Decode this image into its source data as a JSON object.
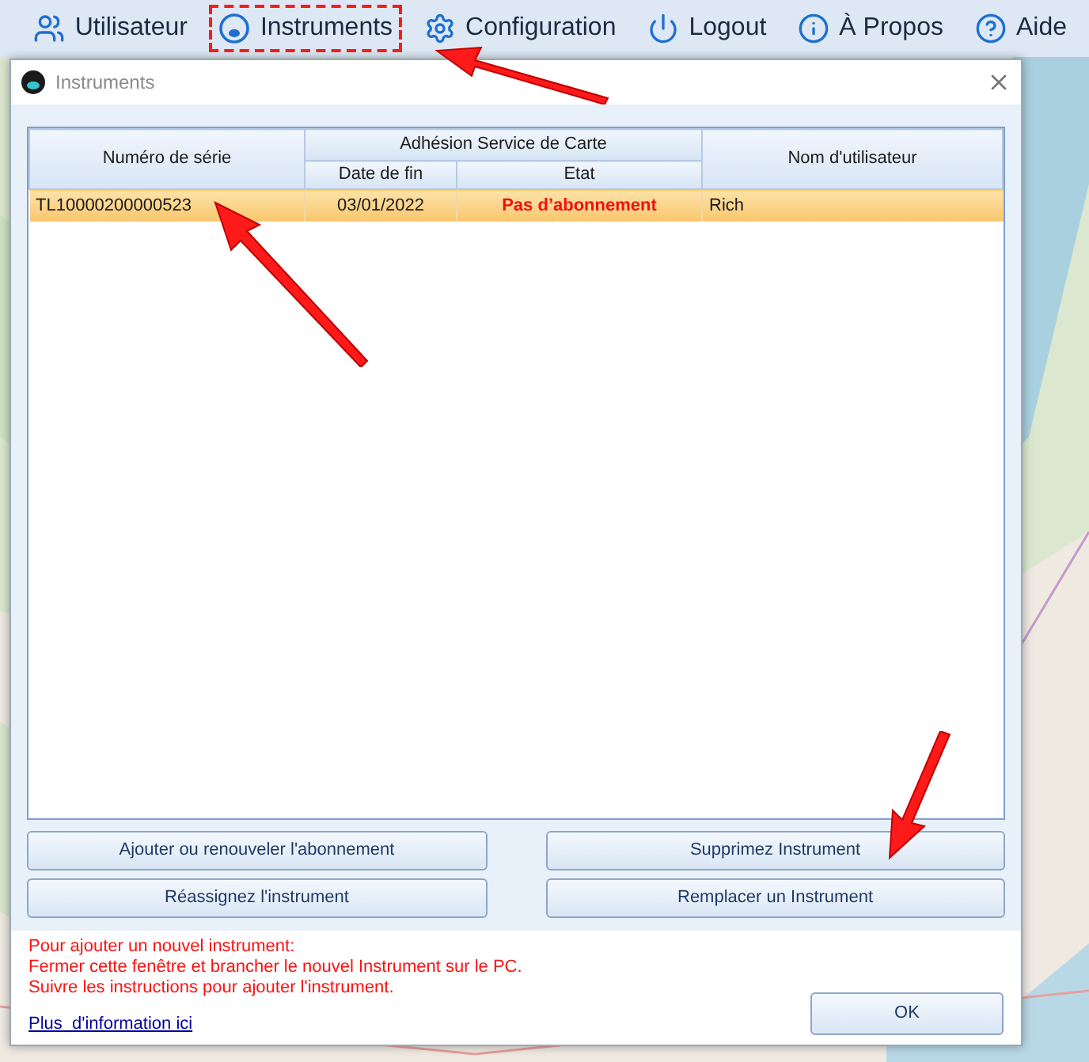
{
  "toolbar": [
    {
      "label": "Utilisateur",
      "kind": "users",
      "selected": false
    },
    {
      "label": "Instruments",
      "kind": "instrument",
      "selected": true
    },
    {
      "label": "Configuration",
      "kind": "gear",
      "selected": false
    },
    {
      "label": "Logout",
      "kind": "power",
      "selected": false
    },
    {
      "label": "À Propos",
      "kind": "info",
      "selected": false
    },
    {
      "label": "Aide",
      "kind": "help",
      "selected": false
    }
  ],
  "dialog": {
    "title": "Instruments",
    "table": {
      "columns": {
        "serial": "Numéro de série",
        "group": "Adhésion Service de Carte",
        "end_date": "Date de fin",
        "state": "Etat",
        "user": "Nom d'utilisateur"
      },
      "rows": [
        {
          "serial": "TL10000200000523",
          "end_date": "03/01/2022",
          "state": "Pas d’abonnement",
          "user": "Rich",
          "selected": true
        }
      ]
    },
    "buttons": [
      "Ajouter ou renouveler l'abonnement",
      "Supprimez Instrument",
      "Réassignez l'instrument",
      "Remplacer un Instrument"
    ],
    "notice": [
      "Pour ajouter un nouvel instrument:",
      "Fermer cette fenêtre et brancher le nouvel Instrument sur le PC.",
      "Suivre les instructions pour ajouter l'instrument."
    ],
    "link": "Plus  d'information ici",
    "ok": "OK"
  }
}
